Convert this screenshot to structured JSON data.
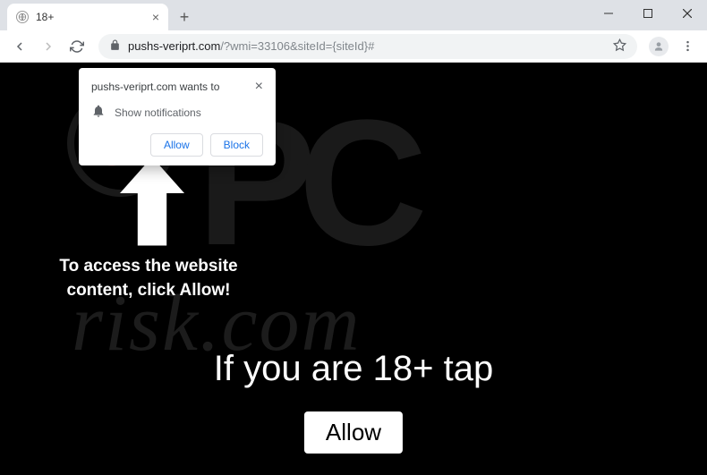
{
  "tab": {
    "title": "18+"
  },
  "address": {
    "host": "pushs-veriprt.com",
    "path": "/?wmi=33106&siteId={siteId}#"
  },
  "notification": {
    "wants_to": "pushs-veriprt.com wants to",
    "show": "Show notifications",
    "allow": "Allow",
    "block": "Block"
  },
  "page": {
    "instruction": "To access the website content, click Allow!",
    "headline": "If you are 18+ tap",
    "button": "Allow"
  },
  "watermark": {
    "risk": "risk.com"
  }
}
